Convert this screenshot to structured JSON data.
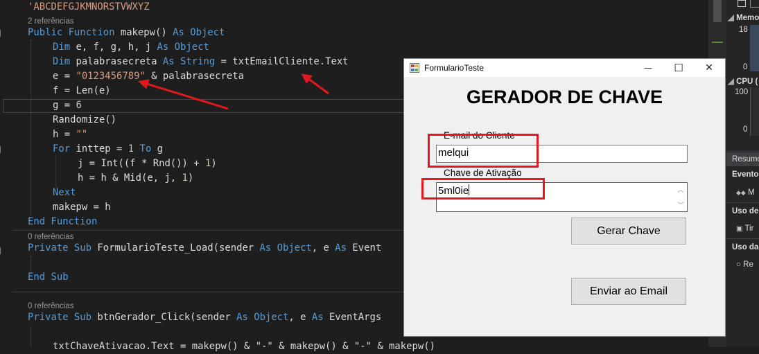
{
  "editor": {
    "lines": [
      {
        "segs": [
          {
            "t": "'ABCDEFGJKMNORSTVWXYZ",
            "c": "str"
          }
        ]
      },
      {
        "codelens": "2 referências"
      },
      {
        "segs": [
          {
            "t": "Public",
            "c": "kw"
          },
          {
            "t": " "
          },
          {
            "t": "Function",
            "c": "kw"
          },
          {
            "t": " makepw() "
          },
          {
            "t": "As",
            "c": "kw"
          },
          {
            "t": " "
          },
          {
            "t": "Object",
            "c": "kw"
          }
        ]
      },
      {
        "segs": [
          {
            "t": "Dim",
            "c": "kw"
          },
          {
            "t": " e, f, g, h, j "
          },
          {
            "t": "As",
            "c": "kw"
          },
          {
            "t": " "
          },
          {
            "t": "Object",
            "c": "kw"
          }
        ]
      },
      {
        "segs": [
          {
            "t": "Dim",
            "c": "kw"
          },
          {
            "t": " palabrasecreta "
          },
          {
            "t": "As",
            "c": "kw"
          },
          {
            "t": " "
          },
          {
            "t": "String",
            "c": "kw"
          },
          {
            "t": " = txtEmailCliente.Text"
          }
        ]
      },
      {
        "segs": [
          {
            "t": "e = "
          },
          {
            "t": "\"0123456789\"",
            "c": "str"
          },
          {
            "t": " & palabrasecreta"
          }
        ]
      },
      {
        "segs": [
          {
            "t": "f = Len(e)"
          }
        ]
      },
      {
        "segs": [
          {
            "t": "g = "
          },
          {
            "t": "6",
            "c": "num"
          }
        ]
      },
      {
        "segs": [
          {
            "t": "Randomize()"
          }
        ]
      },
      {
        "segs": [
          {
            "t": "h = "
          },
          {
            "t": "\"\"",
            "c": "str"
          }
        ]
      },
      {
        "segs": [
          {
            "t": "For",
            "c": "kw"
          },
          {
            "t": " inttep = "
          },
          {
            "t": "1",
            "c": "num"
          },
          {
            "t": " "
          },
          {
            "t": "To",
            "c": "kw"
          },
          {
            "t": " g"
          }
        ]
      },
      {
        "segs": [
          {
            "t": "j = Int((f * Rnd()) + "
          },
          {
            "t": "1",
            "c": "num"
          },
          {
            "t": ")"
          }
        ]
      },
      {
        "segs": [
          {
            "t": "h = h & Mid(e, j, "
          },
          {
            "t": "1",
            "c": "num"
          },
          {
            "t": ")"
          }
        ]
      },
      {
        "segs": [
          {
            "t": "Next",
            "c": "kw"
          }
        ]
      },
      {
        "segs": [
          {
            "t": "makepw = h"
          }
        ]
      },
      {
        "segs": [
          {
            "t": "End",
            "c": "kw"
          },
          {
            "t": " "
          },
          {
            "t": "Function",
            "c": "kw"
          }
        ]
      },
      {
        "codelens": "0 referências"
      },
      {
        "segs": [
          {
            "t": "Private",
            "c": "kw"
          },
          {
            "t": " "
          },
          {
            "t": "Sub",
            "c": "kw"
          },
          {
            "t": " FormularioTeste_Load(sender "
          },
          {
            "t": "As",
            "c": "kw"
          },
          {
            "t": " "
          },
          {
            "t": "Object",
            "c": "kw"
          },
          {
            "t": ", e "
          },
          {
            "t": "As",
            "c": "kw"
          },
          {
            "t": " Event"
          }
        ]
      },
      {
        "segs": []
      },
      {
        "segs": [
          {
            "t": "End",
            "c": "kw"
          },
          {
            "t": " "
          },
          {
            "t": "Sub",
            "c": "kw"
          }
        ]
      },
      {
        "segs": []
      },
      {
        "codelens": "0 referências"
      },
      {
        "segs": [
          {
            "t": "Private",
            "c": "kw"
          },
          {
            "t": " "
          },
          {
            "t": "Sub",
            "c": "kw"
          },
          {
            "t": " btnGerador_Click(sender "
          },
          {
            "t": "As",
            "c": "kw"
          },
          {
            "t": " "
          },
          {
            "t": "Object",
            "c": "kw"
          },
          {
            "t": ", e "
          },
          {
            "t": "As",
            "c": "kw"
          },
          {
            "t": " EventArgs"
          }
        ]
      },
      {
        "segs": []
      },
      {
        "segs": [
          {
            "t": "txtChaveAtivacao.Text = makepw() & \"-\" & makepw() & \"-\" & makepw()"
          }
        ]
      }
    ]
  },
  "diagnostics": {
    "memory_label": "Memo",
    "memory_max": "18",
    "memory_min": "0",
    "cpu_label": "CPU (",
    "cpu_max": "100",
    "cpu_min": "0",
    "tab_label": "Resumo",
    "events_label": "Eventos",
    "events_item": "M",
    "memory_use_label": "Uso de",
    "memory_use_item": "Tir",
    "cpu_use_label": "Uso da",
    "cpu_use_item": "Re"
  },
  "form": {
    "title": "FormularioTeste",
    "heading": "GERADOR DE CHAVE",
    "email_label": "E-mail do Cliente",
    "email_value": "melqui",
    "key_label": "Chave de Ativação",
    "key_value": "5ml0ie",
    "generate_button": "Gerar Chave",
    "send_button": "Enviar ao Email",
    "minimize": "—",
    "maximize": "☐",
    "close": "✕"
  },
  "annotations": {
    "color": "#e3171e"
  }
}
